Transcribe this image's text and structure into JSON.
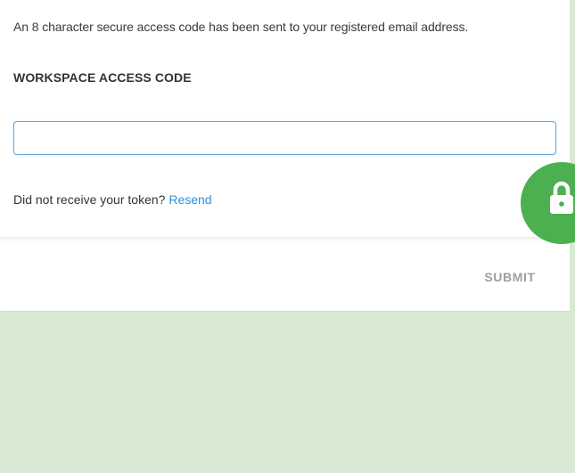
{
  "dialog": {
    "message": "An 8 character secure access code has been sent to your registered email address.",
    "field_label": "WORKSPACE ACCESS CODE",
    "input_value": "",
    "input_placeholder": "",
    "resend_prompt": "Did not receive your token?",
    "resend_link": "Resend",
    "submit_label": "SUBMIT"
  },
  "badge": {
    "icon": "lock-icon",
    "color": "#4caf50"
  },
  "colors": {
    "background": "#d8ead3",
    "link": "#2b90d9",
    "input_border": "#64a7e0",
    "submit_text": "#9e9e9e"
  }
}
